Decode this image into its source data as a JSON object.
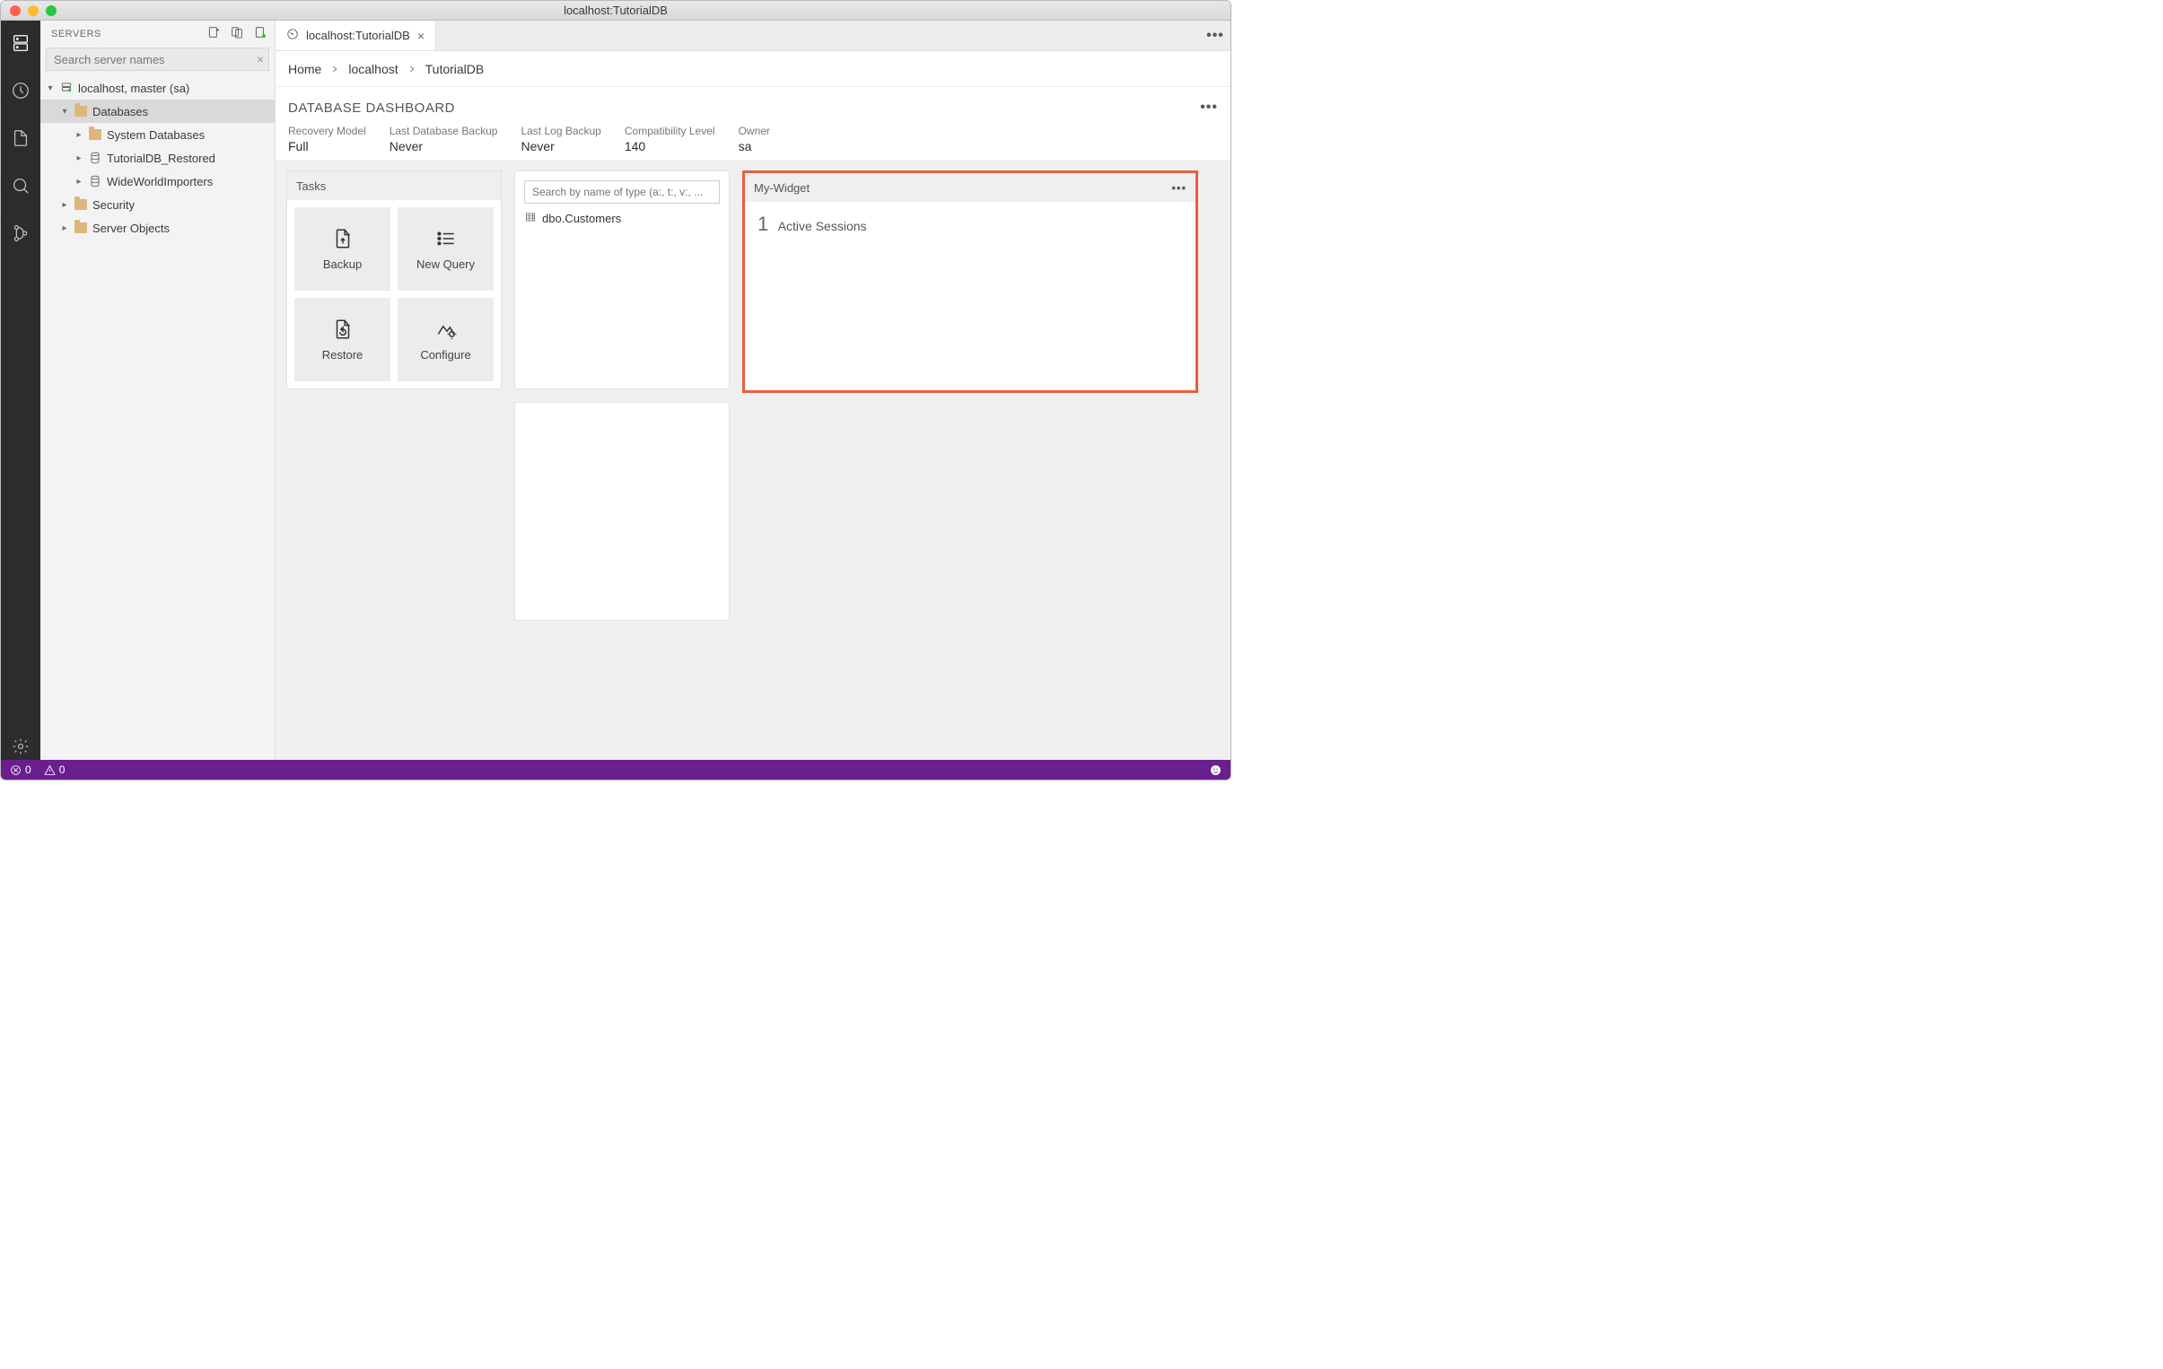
{
  "window": {
    "title": "localhost:TutorialDB"
  },
  "sidebar": {
    "title": "SERVERS",
    "search_placeholder": "Search server names",
    "tree": {
      "server": "localhost, master (sa)",
      "databases_label": "Databases",
      "items": [
        "System Databases",
        "TutorialDB_Restored",
        "WideWorldImporters"
      ],
      "security_label": "Security",
      "server_objects_label": "Server Objects"
    }
  },
  "tab": {
    "title": "localhost:TutorialDB"
  },
  "breadcrumbs": [
    "Home",
    "localhost",
    "TutorialDB"
  ],
  "dashboard": {
    "title": "DATABASE DASHBOARD",
    "props": [
      {
        "label": "Recovery Model",
        "value": "Full"
      },
      {
        "label": "Last Database Backup",
        "value": "Never"
      },
      {
        "label": "Last Log Backup",
        "value": "Never"
      },
      {
        "label": "Compatibility Level",
        "value": "140"
      },
      {
        "label": "Owner",
        "value": "sa"
      }
    ]
  },
  "tasks": {
    "title": "Tasks",
    "items": [
      "Backup",
      "New Query",
      "Restore",
      "Configure"
    ]
  },
  "search_panel": {
    "placeholder": "Search by name of type (a:, t:, v:, ...",
    "result": "dbo.Customers"
  },
  "widget": {
    "title": "My-Widget",
    "count": "1",
    "label": "Active Sessions"
  },
  "statusbar": {
    "errors": "0",
    "warnings": "0"
  }
}
